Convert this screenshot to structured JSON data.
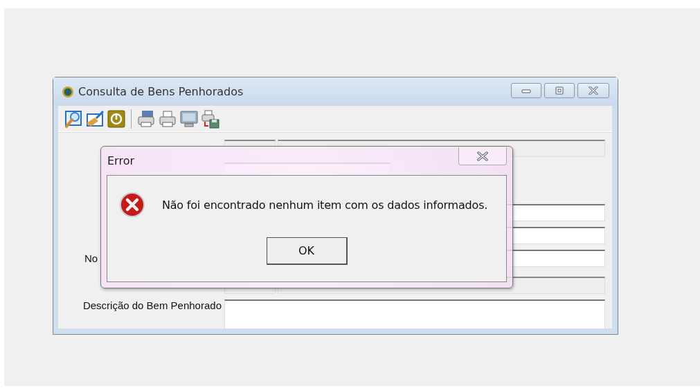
{
  "window": {
    "title": "Consulta de Bens Penhorados"
  },
  "form": {
    "rows": [
      {
        "kind": "pair",
        "readonly": true
      },
      {
        "kind": "short"
      },
      {
        "kind": "text",
        "readonly": false
      },
      {
        "kind": "text",
        "readonly": false
      },
      {
        "kind": "text",
        "readonly": false,
        "label": "No"
      },
      {
        "kind": "pair",
        "readonly": true
      },
      {
        "kind": "area",
        "readonly": false,
        "label": "Descrição do Bem Penhorado"
      }
    ]
  },
  "dialog": {
    "title": "Error",
    "kind": "error",
    "message": "Não foi encontrado nenhum item com os dados informados.",
    "buttons": [
      "OK"
    ]
  }
}
